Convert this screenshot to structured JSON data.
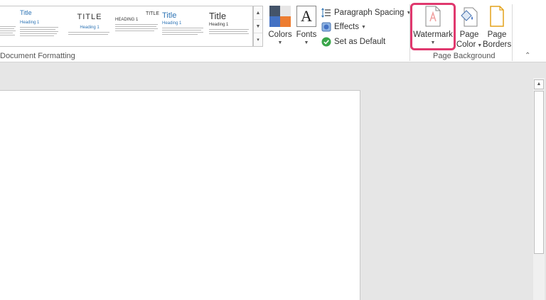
{
  "styles_gallery": {
    "group_label": "Document Formatting",
    "thumbnails": [
      {
        "title": "",
        "heading": ""
      },
      {
        "title": "Title",
        "heading": "Heading 1"
      },
      {
        "title": "TITLE",
        "heading": "Heading 1"
      },
      {
        "title": "TITLE",
        "heading": "HEADING 1"
      },
      {
        "title": "Title",
        "heading": "Heading 1"
      },
      {
        "title": "Title",
        "heading": "Heading 1"
      }
    ]
  },
  "theme_buttons": {
    "colors": "Colors",
    "fonts": "Fonts",
    "fonts_glyph": "A",
    "paragraph_spacing": "Paragraph Spacing",
    "effects": "Effects",
    "set_as_default": "Set as Default"
  },
  "page_background": {
    "group_label": "Page Background",
    "watermark": "Watermark",
    "page_color_line1": "Page",
    "page_color_line2": "Color",
    "page_borders_line1": "Page",
    "page_borders_line2": "Borders"
  },
  "colors": {
    "highlight": "#e0386e",
    "swatch_dark": "#44546a",
    "swatch_light": "#e7e6e6",
    "swatch_blue": "#4472c4",
    "swatch_orange": "#ed7d31",
    "heading_blue": "#2e74b5"
  }
}
